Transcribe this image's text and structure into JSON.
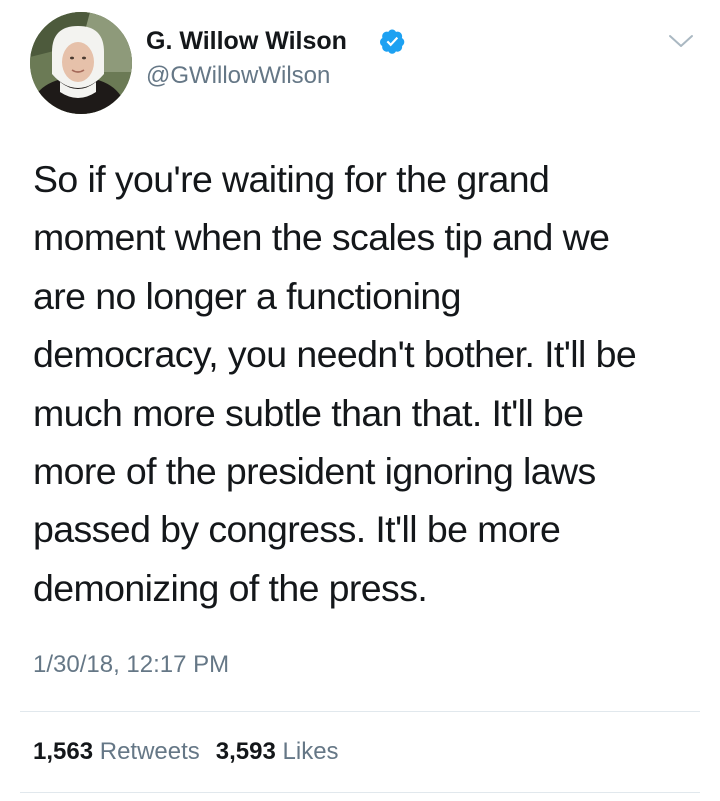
{
  "tweet": {
    "author": {
      "display_name": "G. Willow Wilson",
      "handle": "@GWillowWilson",
      "verified": true
    },
    "text": "So if you're waiting for the grand\nmoment when the scales tip and we\nare no longer a functioning\ndemocracy, you needn't bother. It'll be\nmuch more subtle than that. It'll be\nmore of the president ignoring laws\npassed by congress. It'll be more\ndemonizing of the press.",
    "timestamp": "1/30/18, 12:17 PM",
    "stats": {
      "retweets_count": "1,563",
      "retweets_label": "Retweets",
      "likes_count": "3,593",
      "likes_label": "Likes"
    }
  },
  "icons": {
    "verified": "verified-badge-icon",
    "menu": "chevron-down-icon"
  },
  "colors": {
    "verified_blue": "#1da1f2",
    "text_primary": "#14171a",
    "text_secondary": "#657786",
    "divider": "#e1e8ed"
  }
}
